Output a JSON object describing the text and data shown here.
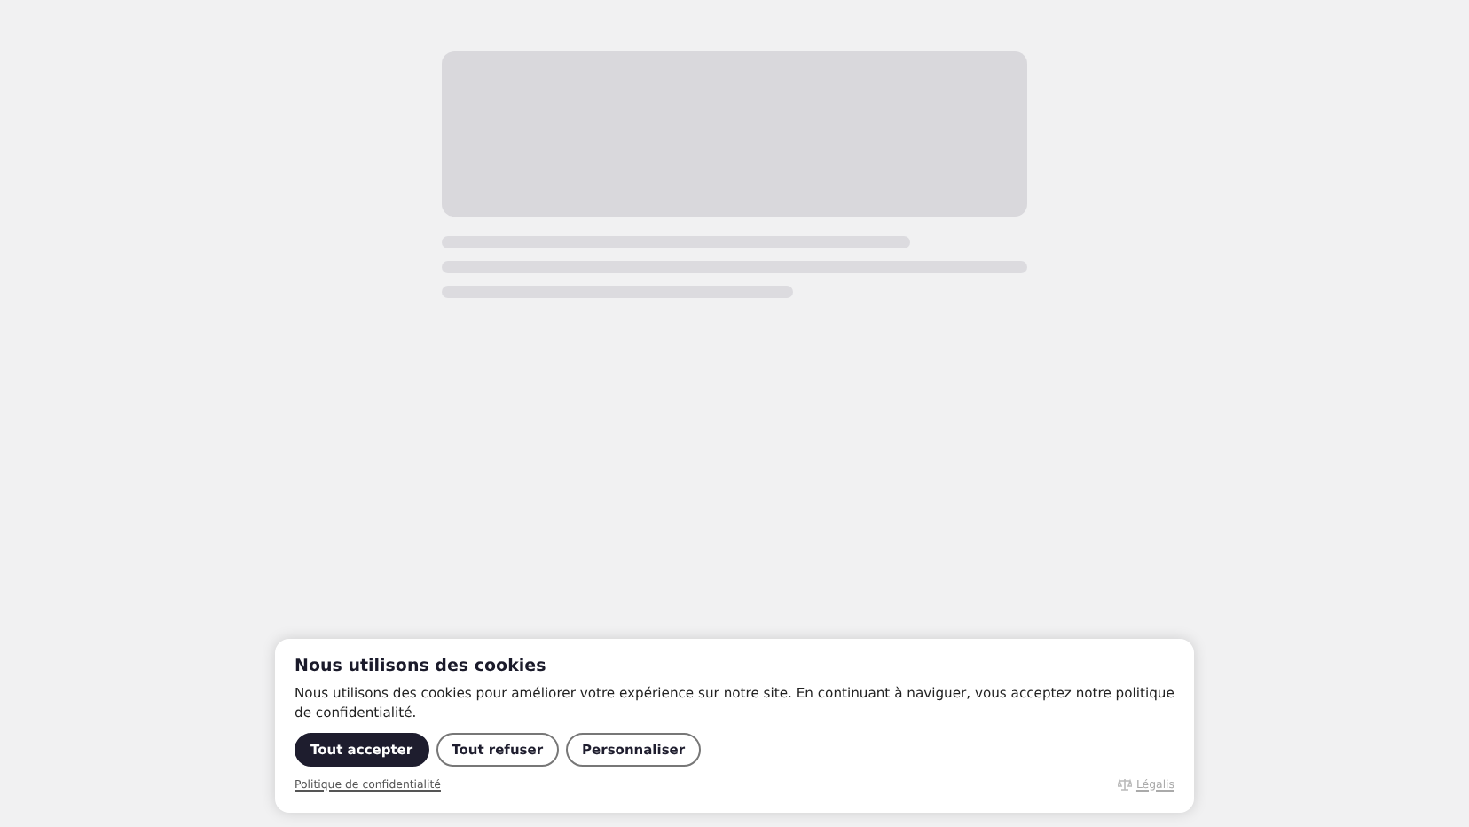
{
  "cookie_banner": {
    "title": "Nous utilisons des cookies",
    "message": "Nous utilisons des cookies pour améliorer votre expérience sur notre site. En continuant à naviguer, vous acceptez notre politique de confidentialité.",
    "buttons": [
      {
        "label": "Tout accepter",
        "kind": "primary"
      },
      {
        "label": "Tout refuser",
        "kind": "outline"
      },
      {
        "label": "Personnaliser",
        "kind": "outline"
      }
    ],
    "privacy_link": "Politique de confidentialité",
    "legal_link": "Légalis"
  }
}
